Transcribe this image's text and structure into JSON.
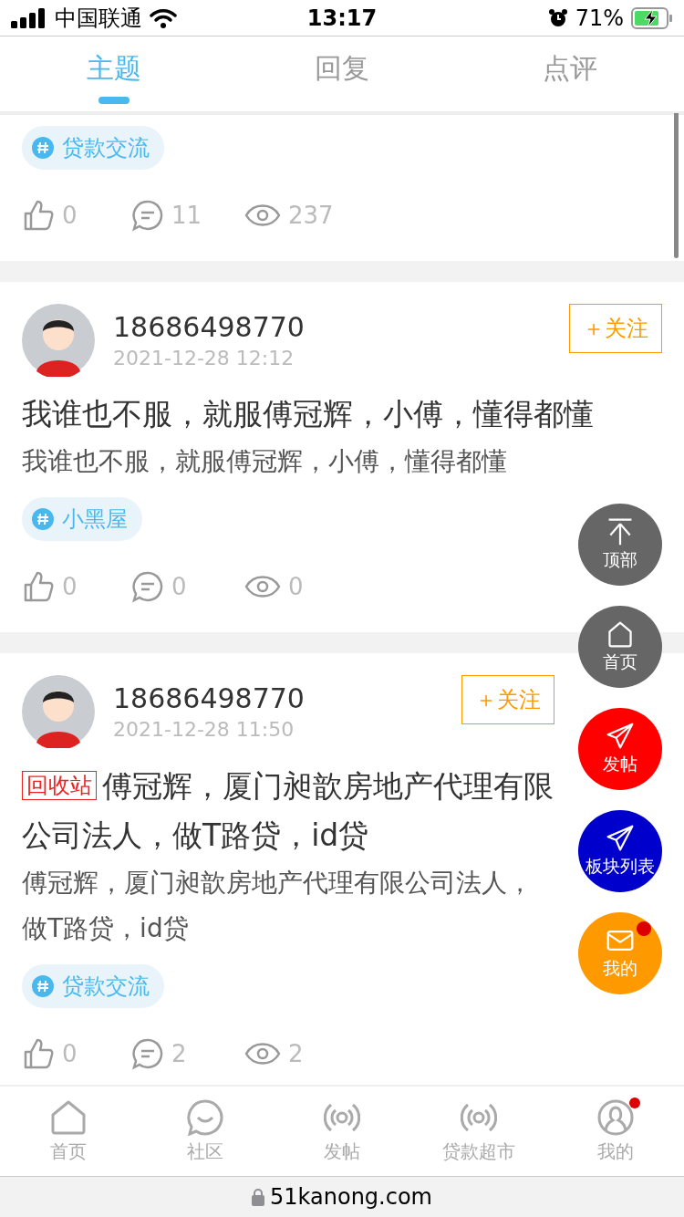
{
  "status_bar": {
    "carrier": "中国联通",
    "time": "13:17",
    "battery": "71%"
  },
  "tabs": [
    {
      "label": "主题",
      "selected": true
    },
    {
      "label": "回复",
      "selected": false
    },
    {
      "label": "点评",
      "selected": false
    }
  ],
  "top_post": {
    "topic": "贷款交流",
    "likes": "0",
    "comments": "11",
    "views": "237"
  },
  "posts": [
    {
      "author": "18686498770",
      "time": "2021-12-28 12:12",
      "follow": "＋关注",
      "title": "我谁也不服，就服傅冠辉，小傅，懂得都懂",
      "body": "我谁也不服，就服傅冠辉，小傅，懂得都懂",
      "topic": "小黑屋",
      "likes": "0",
      "comments": "0",
      "views": "0"
    },
    {
      "author": "18686498770",
      "time": "2021-12-28 11:50",
      "follow": "＋关注",
      "label": "回收站",
      "title": "傅冠辉，厦门昶歆房地产代理有限公司法人，做T路贷，id贷",
      "body": "傅冠辉，厦门昶歆房地产代理有限公司法人，做T路贷，id贷",
      "topic": "贷款交流",
      "likes": "0",
      "comments": "2",
      "views": "2"
    }
  ],
  "float_buttons": [
    {
      "kind": "top",
      "label": "顶部",
      "color": "#666666",
      "badge": false
    },
    {
      "kind": "home",
      "label": "首页",
      "color": "#666666",
      "badge": false
    },
    {
      "kind": "post",
      "label": "发帖",
      "color": "#ff0000",
      "badge": false
    },
    {
      "kind": "boards",
      "label": "板块列表",
      "color": "#0000cc",
      "badge": false
    },
    {
      "kind": "mail",
      "label": "我的",
      "color": "#ff9900",
      "badge": true
    }
  ],
  "bottom_nav": [
    {
      "kind": "home",
      "label": "首页",
      "selected": false,
      "badge": false
    },
    {
      "kind": "community",
      "label": "社区",
      "selected": false,
      "badge": false
    },
    {
      "kind": "broadcast",
      "label": "发帖",
      "selected": false,
      "badge": false
    },
    {
      "kind": "broadcast",
      "label": "贷款超市",
      "selected": false,
      "badge": false
    },
    {
      "kind": "profile",
      "label": "我的",
      "selected": false,
      "badge": true
    }
  ],
  "url_bar": {
    "url": "51kanong.com"
  }
}
